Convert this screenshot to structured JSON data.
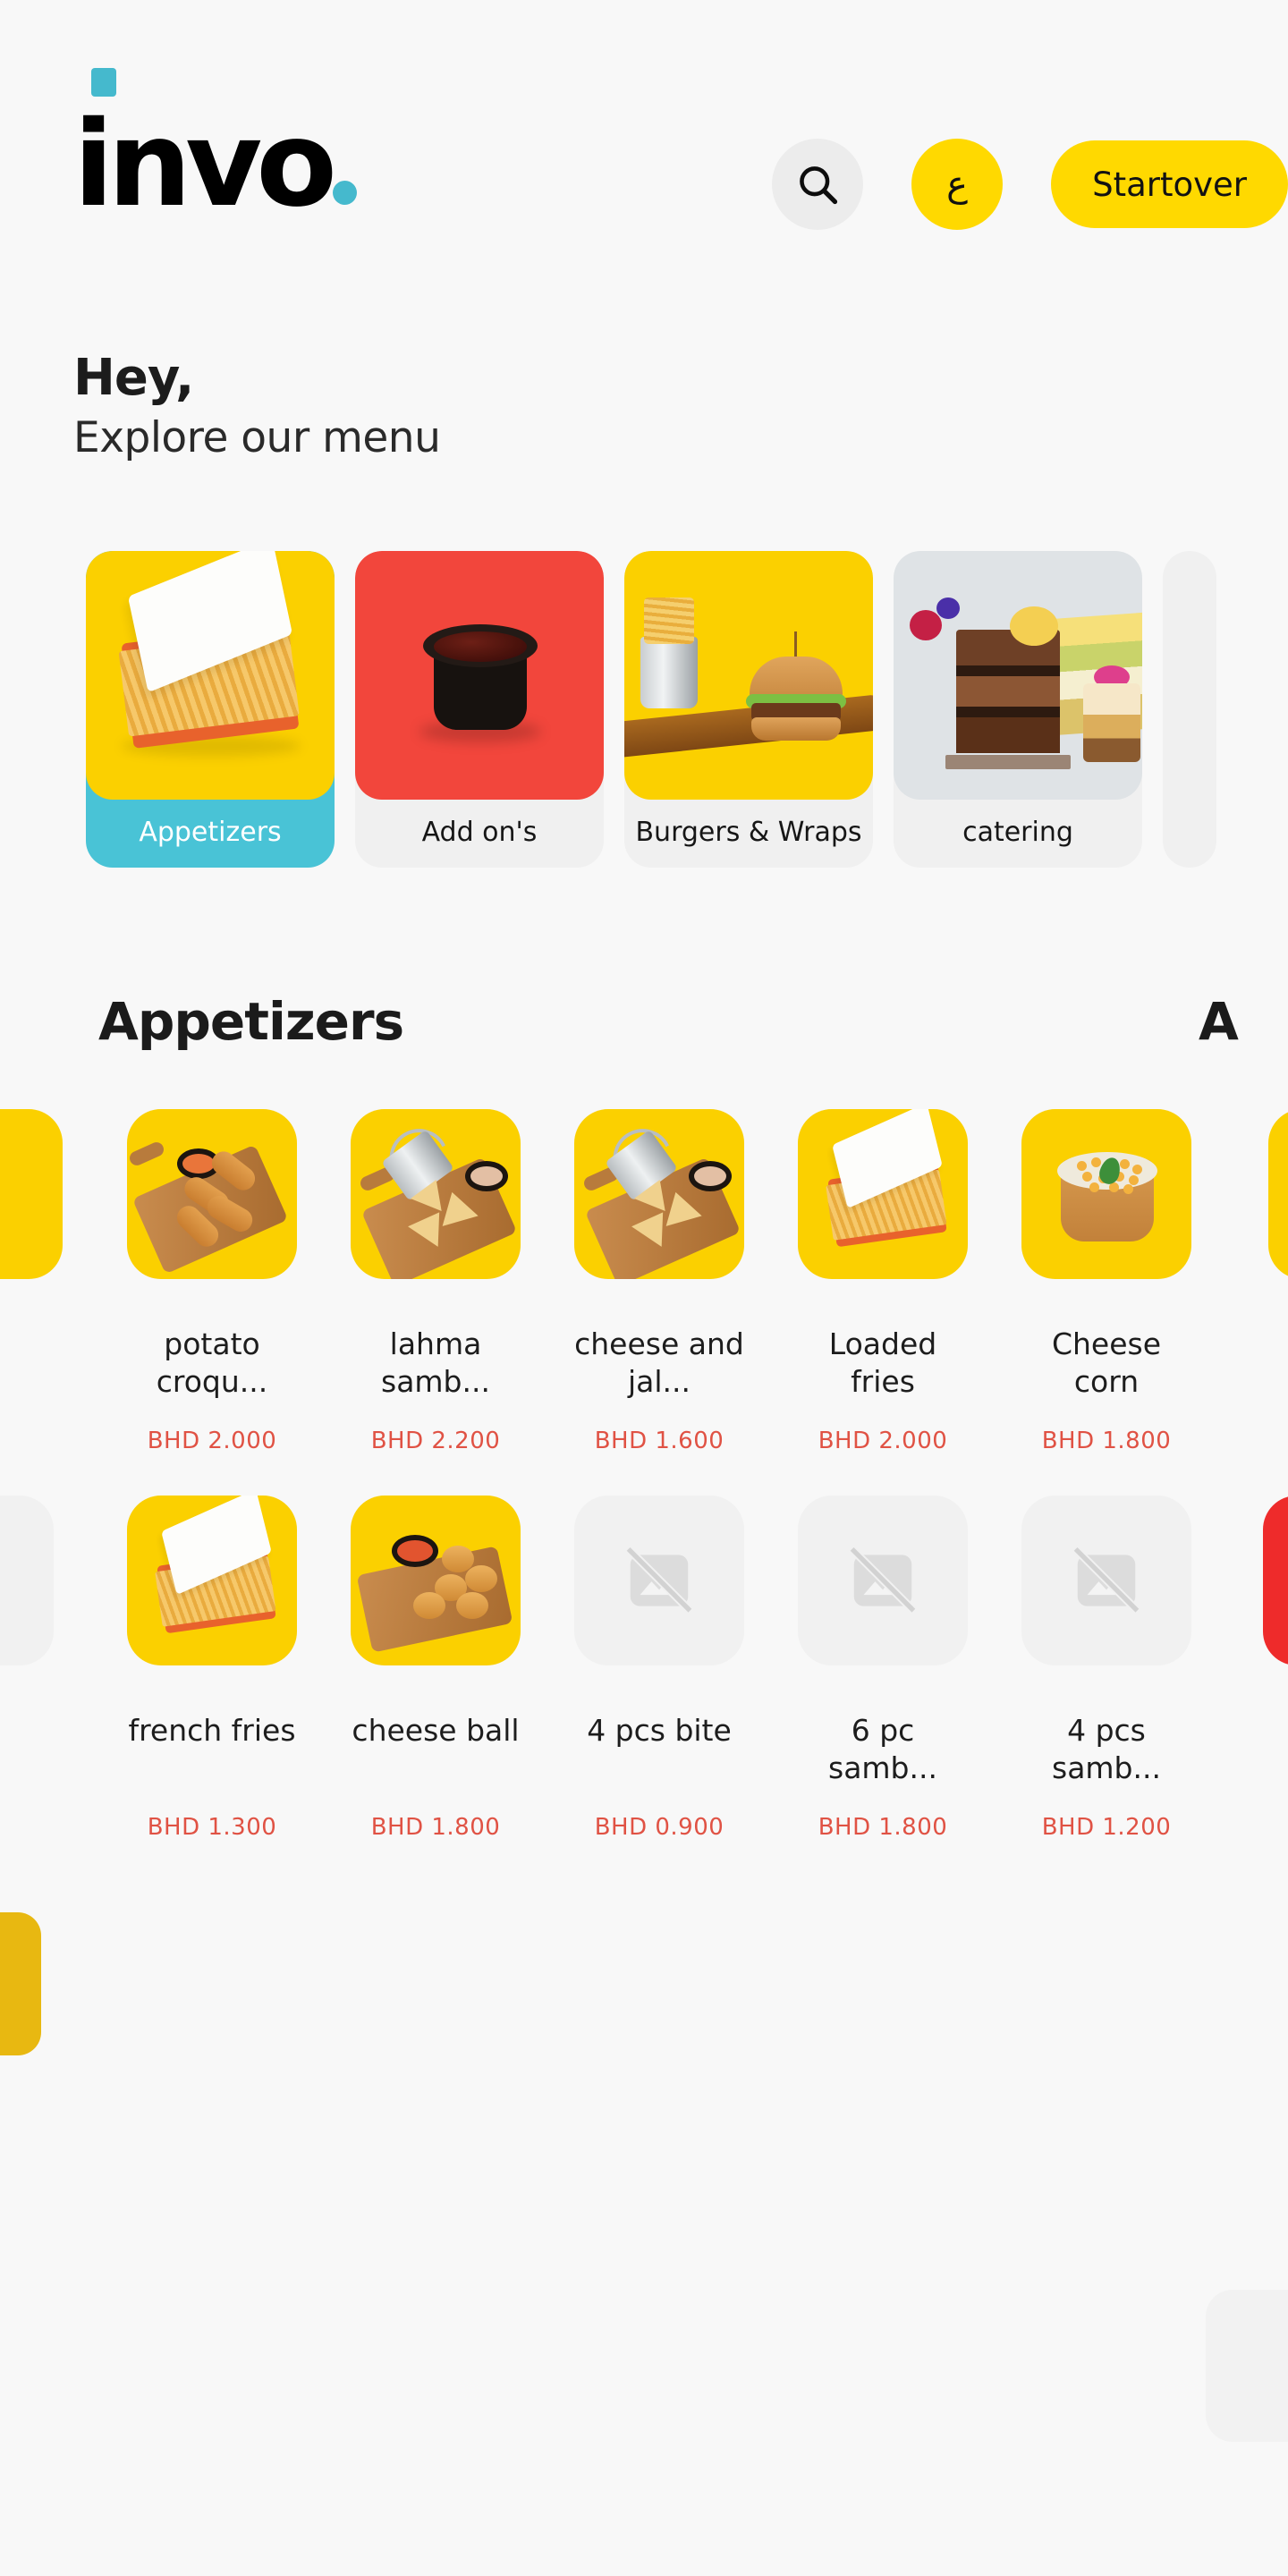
{
  "brand": {
    "name": "invo",
    "accent_color": "#45b9cd",
    "dot": "."
  },
  "header": {
    "search_icon": "search-icon",
    "language_label": "ع",
    "startover_label": "Startover"
  },
  "greeting": {
    "title": "Hey,",
    "subtitle": "Explore our menu"
  },
  "categories": {
    "items": [
      {
        "label": "Appetizers",
        "selected": true,
        "theme": "yellow"
      },
      {
        "label": "Add on's",
        "selected": false,
        "theme": "red"
      },
      {
        "label": "Burgers & Wraps",
        "selected": false,
        "theme": "yellow"
      },
      {
        "label": "catering",
        "selected": false,
        "theme": "grey"
      }
    ]
  },
  "section": {
    "title": "Appetizers",
    "next_title": "A"
  },
  "menu": {
    "currency": "BHD",
    "items": [
      {
        "name": "potato croqu...",
        "price": "BHD  2.000",
        "has_image": true,
        "scene": "croquettes"
      },
      {
        "name": "lahma samb...",
        "price": "BHD  2.200",
        "has_image": true,
        "scene": "samosa"
      },
      {
        "name": "cheese and jal...",
        "price": "BHD  1.600",
        "has_image": true,
        "scene": "samosa"
      },
      {
        "name": "Loaded fries",
        "price": "BHD  2.000",
        "has_image": true,
        "scene": "friesbox"
      },
      {
        "name": "Cheese corn",
        "price": "BHD  1.800",
        "has_image": true,
        "scene": "cheesecorn"
      },
      {
        "name": "french fries",
        "price": "BHD  1.300",
        "has_image": true,
        "scene": "friesbox"
      },
      {
        "name": "cheese ball",
        "price": "BHD  1.800",
        "has_image": true,
        "scene": "cheeseball"
      },
      {
        "name": "4 pcs bite",
        "price": "BHD  0.900",
        "has_image": false,
        "scene": "none"
      },
      {
        "name": "6 pc samb...",
        "price": "BHD  1.800",
        "has_image": false,
        "scene": "none"
      },
      {
        "name": "4 pcs samb...",
        "price": "BHD  1.200",
        "has_image": false,
        "scene": "none"
      }
    ]
  },
  "colors": {
    "page_bg": "#f8f8f8",
    "accent_yellow": "#ffd900",
    "selected_cyan": "#49c3d6",
    "price_red": "#e05244",
    "card_grey": "#f0f0f0"
  }
}
